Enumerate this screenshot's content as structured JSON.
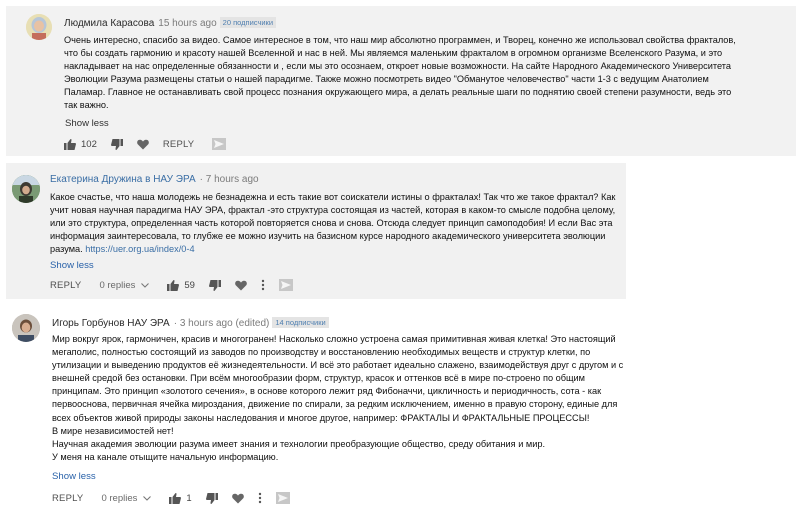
{
  "comments": [
    {
      "author": "Людмила Карасова",
      "time": "15 hours ago",
      "badge": "20 подписчики",
      "lines": [
        "Очень интересно, спасибо за видео. Самое интересное в том, что наш мир абсолютно программен, и Творец,  конечно же использовал свойства фракталов,",
        "что бы создать гармонию и красоту нашей Вселенной и нас в ней. Мы являемся маленьким фракталом в огромном организме Вселенского Разума, и это",
        "накладывает на нас определенные обязанности и , если мы это осознаем, откроет новые возможности. На сайте Народного Академического Университета",
        "Эволюции Разума размещены статьи о нашей парадигме. Также можно посмотреть видео \"Обманутое человечество\" части 1-3 с ведущим Анатолием",
        "Паламар. Главное не останавливать свой процесс познания окружающего мира, а  делать реальные шаги по поднятию своей степени разумности, ведь это",
        "так важно."
      ],
      "show_less": "Show less",
      "likes": "102",
      "reply": "REPLY"
    },
    {
      "author": "Екатерина Дружина в НАУ ЭРА",
      "time": "· 7 hours ago",
      "lines": [
        "Какое счастье, что наша молодежь не безнадежна и есть такие вот соискатели истины о фракталах! Так что же такое фрактал? Как",
        "учит новая научная парадигма НАУ ЭРА, фрактал -это структура состоящая  из частей, которая в каком-то смысле подобна целому,",
        "или это структура, определенная часть которой повторяется снова и снова. Отсюда следует принцип самоподобия! И если Вас эта",
        "информация заинтересовала, то глубже ее можно изучить на базисном курсе народного академического университета эволюции",
        "разума."
      ],
      "link": "https://uer.org.ua/index/0-4",
      "show_less": "Show less",
      "reply": "REPLY",
      "replies": "0 replies",
      "likes": "59"
    },
    {
      "author": "Игорь Горбунов НАУ ЭРА",
      "time": "· 3 hours ago (edited)",
      "badge": "14 подписчики",
      "lines": [
        "Мир вокруг ярок, гармоничен, красив и многогранен! Насколько сложно устроена самая примитивная живая клетка! Это настоящий",
        "мегаполис, полностью состоящий из заводов по производству и восстановлению необходимых веществ и структур клетки, по",
        "утилизации и выведению продуктов её жизнедеятельности. И всё это работает идеально слажено, взаимодействуя друг с другом и с",
        "внешней средой без остановки. При всём многообразии форм, структур, красок и оттенков всё в мире по-строено по общим",
        "принципам. Это принцип «золотого сечения», в основе которого лежит ряд Фибоначчи, цикличность и периодичность, сота - как",
        "первооснова, первичная ячейка мироздания, движение по спирали, за редким исключением, именно в правую сторону, единые для",
        "всех объектов живой природы законы наследования и многое другое, например: ФРАКТАЛЫ И ФРАКТАЛЬНЫЕ ПРОЦЕССЫ!",
        "В мире независимостей нет!",
        "Научная академия эволюции разума имеет знания и технологии преобразующие общество, среду обитания и мир.",
        "У меня на канале отыщите начальную информацию."
      ],
      "show_less": "Show less",
      "reply": "REPLY",
      "replies": "0 replies",
      "likes": "1"
    }
  ]
}
